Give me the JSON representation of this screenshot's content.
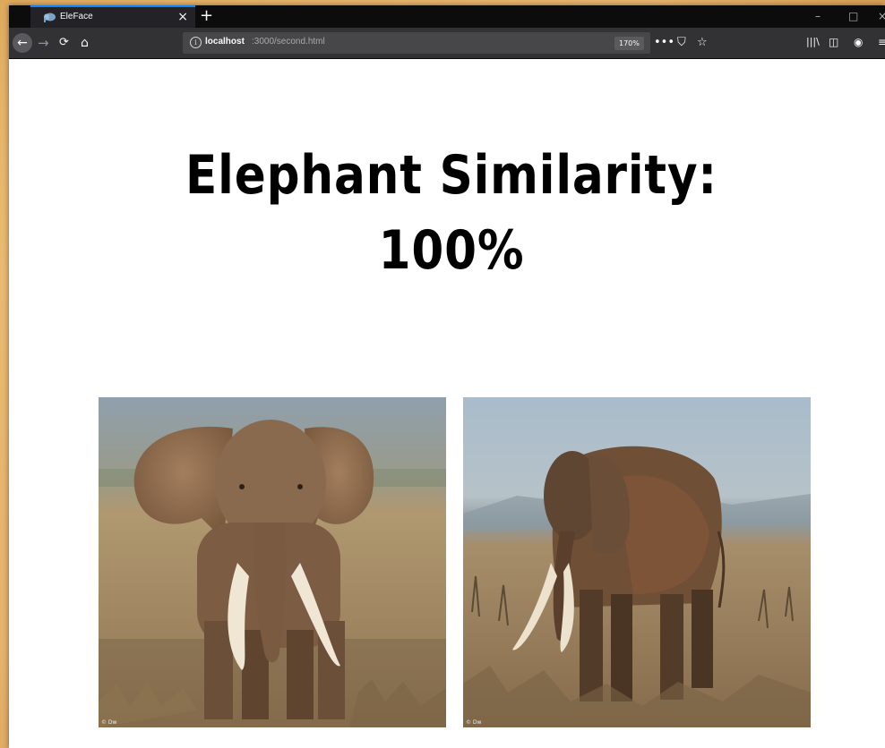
{
  "browser": {
    "tab_title": "EleFace",
    "url_host": "localhost",
    "url_path": ":3000/second.html",
    "zoom": "170%"
  },
  "page": {
    "heading_line1": "Elephant Similarity:",
    "heading_line2": "100%"
  },
  "images": [
    {
      "alt": "elephant-front",
      "watermark": "© Dw"
    },
    {
      "alt": "elephant-side",
      "watermark": "© Dw"
    }
  ],
  "icons": {
    "back": "arrow-left-icon",
    "forward": "arrow-right-icon",
    "reload": "reload-icon",
    "home": "home-icon",
    "info": "info-icon",
    "more": "ellipsis-icon",
    "pocket": "pocket-icon",
    "bookmark": "star-icon",
    "library": "library-icon",
    "sidebar": "sidebar-icon",
    "account": "account-icon",
    "menu": "hamburger-icon"
  }
}
